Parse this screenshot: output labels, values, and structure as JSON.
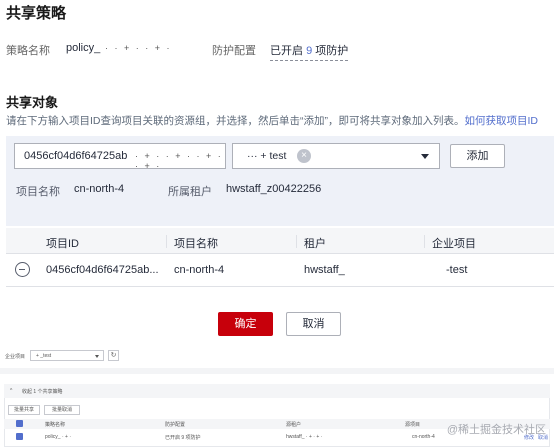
{
  "header": {
    "title": "共享策略"
  },
  "policy": {
    "name_label": "策略名称",
    "name_value": "policy_",
    "name_tail": "· · + · · + ·",
    "protect_label": "防护配置",
    "protect_prefix": "已开启",
    "protect_count": "9",
    "protect_suffix": "项防护"
  },
  "share": {
    "title": "共享对象",
    "description": "请在下方输入项目ID查询项目关联的资源组，并选择，然后单击“添加”，即可将共享对象加入列表。",
    "help_link": "如何获取项目ID"
  },
  "search": {
    "project_id_value": "0456cf04d6f64725ab",
    "project_id_tail": "· + · · + · · + · · + ·",
    "group_tag": "··· + test",
    "add_button": "添加"
  },
  "info": {
    "project_name_label": "项目名称",
    "project_name_value": "cn-north-4",
    "tenant_label": "所属租户",
    "tenant_value": "hwstaff_z00422256"
  },
  "table": {
    "columns": [
      "项目ID",
      "项目名称",
      "租户",
      "企业项目"
    ],
    "rows": [
      {
        "project_id": "0456cf04d6f64725ab...",
        "project_name": "cn-north-4",
        "tenant": "hwstaff_",
        "enterprise_project": "-test"
      }
    ]
  },
  "actions": {
    "confirm": "确定",
    "cancel": "取消"
  },
  "lower": {
    "enterprise_label": "企业项目",
    "enterprise_value": "+ _test",
    "section_title": "收起 1 个共享策略",
    "batch_share": "批量共享",
    "batch_cancel": "批量取消",
    "cols": [
      "策略名称",
      "防护配置",
      "源租户",
      "源项目"
    ],
    "row": {
      "name": "policy_ · + ·",
      "protect": "已开启 9 项防护",
      "tenant": "hwstaff_ · + · + ·",
      "project": "cn-north-4",
      "op1": "修改",
      "op2": "取消"
    }
  },
  "watermark": "@稀土掘金技术社区",
  "colors": {
    "primary_red": "#c7000b",
    "link_blue": "#526ecc",
    "panel_bg": "#eef1f8"
  }
}
